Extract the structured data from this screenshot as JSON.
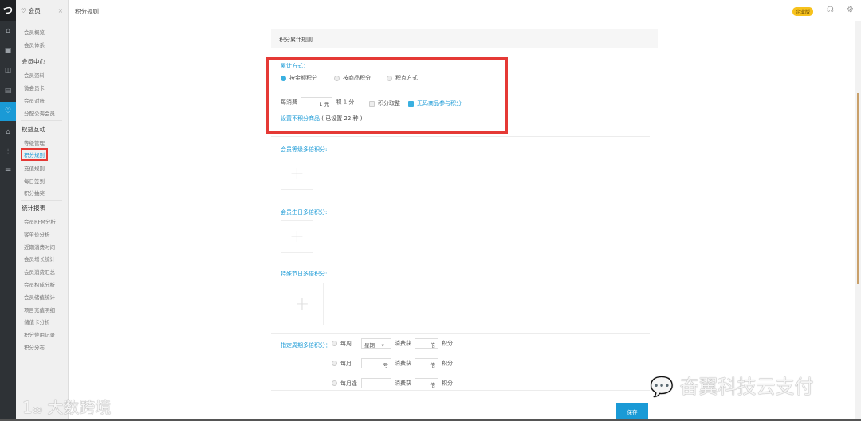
{
  "rail": {
    "logo": "つ",
    "icons": [
      "home-icon",
      "cashier-icon",
      "goods-icon",
      "report-icon",
      "member-icon",
      "shop-icon",
      "chart-icon",
      "menu-icon"
    ],
    "active": "member-icon",
    "accent": "#1a9ad6"
  },
  "sidebar": {
    "title": "会员",
    "close": "×",
    "items_top": [
      "会员概览",
      "会员体系"
    ],
    "groups": [
      {
        "label": "会员中心",
        "items": [
          "会员资料",
          "微会员卡",
          "会员对账",
          "分配公海会员"
        ]
      },
      {
        "label": "权益互动",
        "items": [
          "等级管理",
          "积分规则",
          "充值规则",
          "每日签到",
          "积分抽奖"
        ]
      },
      {
        "label": "统计报表",
        "items": [
          "会员RFM分析",
          "客单价分析",
          "近期消费时间",
          "会员增长统计",
          "会员消费汇总",
          "会员构成分析",
          "会员储值统计",
          "项目充值明细",
          "储值卡分析",
          "积分使用记录",
          "积分分布"
        ]
      }
    ],
    "selected": "积分规则"
  },
  "header": {
    "title": "积分规则",
    "badge": "企业版",
    "icons": [
      "headset-icon",
      "settings-icon"
    ]
  },
  "main": {
    "card_title": "积分累计规则",
    "accumulate_label": "累计方式：",
    "methods": [
      {
        "label": "按金额积分",
        "checked": true
      },
      {
        "label": "按商品积分",
        "checked": false
      },
      {
        "label": "积点方式",
        "checked": false
      }
    ],
    "per_spend": "每消费",
    "per_value": "1",
    "yuan": "元",
    "earn": "积 1 分",
    "round": {
      "label": "积分取整",
      "checked": false
    },
    "nocode": {
      "label": "无码商品参与积分",
      "checked": true
    },
    "exclude_link": "设置不积分商品",
    "exclude_count": "( 已设置 22 种 )",
    "sections": [
      "会员等级多倍积分:",
      "会员生日多倍积分:",
      "特殊节日多倍积分:"
    ],
    "period_label": "指定周期多倍积分：",
    "period_rows": [
      {
        "label": "每周",
        "select": "星期一",
        "unit": "",
        "spend": "消费获",
        "times": "倍",
        "points": "积分"
      },
      {
        "label": "每月",
        "select": "",
        "unit": "号",
        "spend": "消费获",
        "times": "倍",
        "points": "积分"
      },
      {
        "label": "每月逢",
        "select": "",
        "unit": "",
        "spend": "消费获",
        "times": "倍",
        "points": "积分"
      }
    ],
    "save": "保存"
  },
  "watermarks": {
    "left": "大数跨境",
    "right": "奋翼科技云支付"
  }
}
